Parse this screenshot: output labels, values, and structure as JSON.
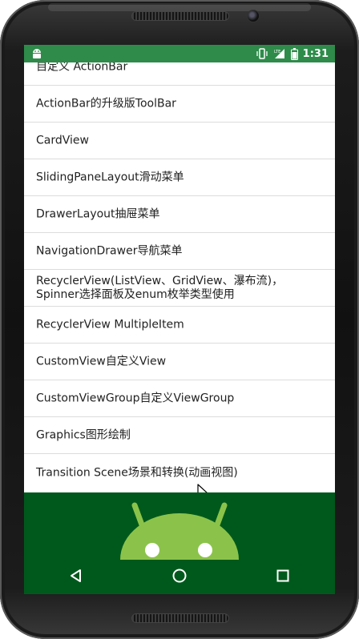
{
  "status_bar": {
    "time": "1:31",
    "icons": [
      "android-notification-icon",
      "vibrate-icon",
      "lte-signal-icon",
      "battery-icon"
    ],
    "background_color": "#2e8b4a"
  },
  "list": {
    "items": [
      {
        "label": "自定义 ActionBar"
      },
      {
        "label": "ActionBar的升级版ToolBar"
      },
      {
        "label": "CardView"
      },
      {
        "label": "SlidingPaneLayout滑动菜单"
      },
      {
        "label": "DrawerLayout抽屉菜单"
      },
      {
        "label": "NavigationDrawer导航菜单"
      },
      {
        "label": "RecyclerView(ListView、GridView、瀑布流)，\nSpinner选择面板及enum枚举类型使用"
      },
      {
        "label": "RecyclerView MultipleItem"
      },
      {
        "label": "CustomView自定义View"
      },
      {
        "label": "CustomViewGroup自定义ViewGroup"
      },
      {
        "label": "Graphics图形绘制"
      },
      {
        "label": "Transition Scene场景和转换(动画视图)"
      }
    ]
  },
  "hero": {
    "icon": "android-robot-icon",
    "background_color": "#00591c",
    "robot_color": "#8bc34a"
  },
  "nav_bar": {
    "buttons": [
      "back-icon",
      "home-icon",
      "recents-icon"
    ]
  }
}
